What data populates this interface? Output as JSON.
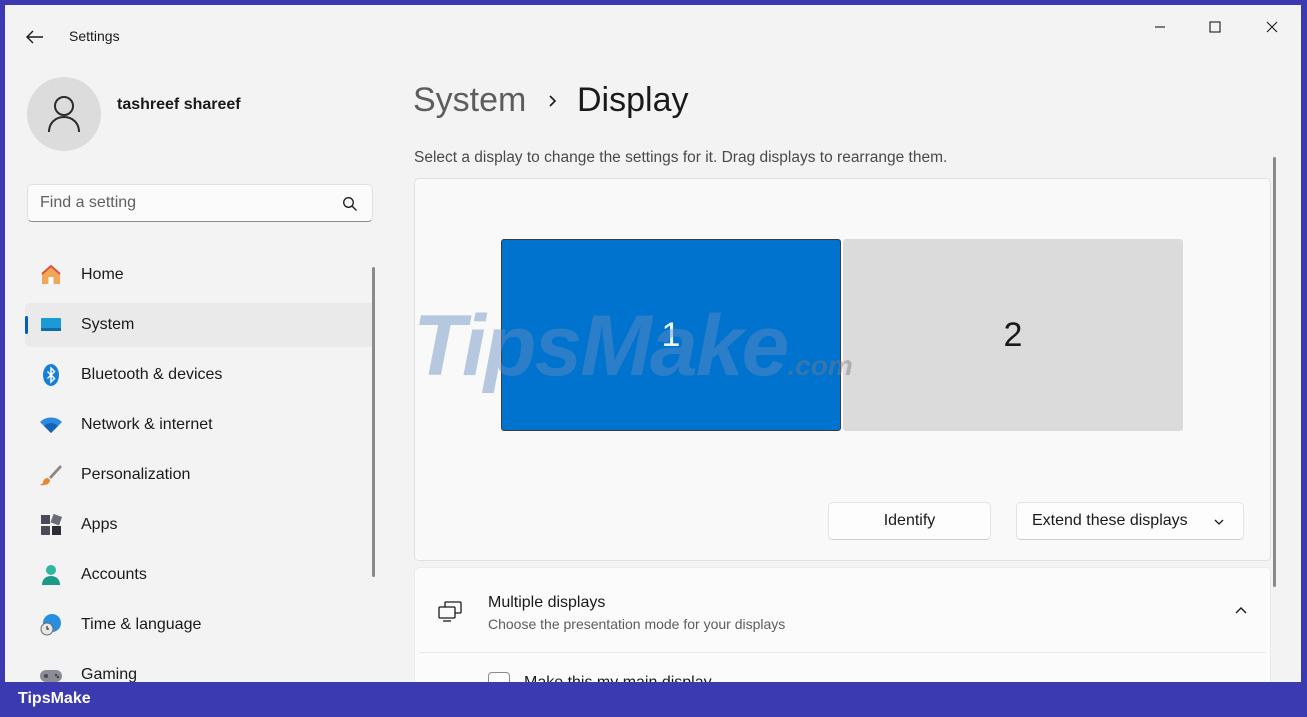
{
  "window": {
    "title": "Settings",
    "controls": [
      "minimize",
      "maximize",
      "close"
    ]
  },
  "user": {
    "name": "tashreef shareef"
  },
  "search": {
    "placeholder": "Find a setting"
  },
  "sidebar": {
    "items": [
      {
        "label": "Home",
        "icon": "home-icon",
        "active": false
      },
      {
        "label": "System",
        "icon": "system-icon",
        "active": true
      },
      {
        "label": "Bluetooth & devices",
        "icon": "bluetooth-icon",
        "active": false
      },
      {
        "label": "Network & internet",
        "icon": "wifi-icon",
        "active": false
      },
      {
        "label": "Personalization",
        "icon": "brush-icon",
        "active": false
      },
      {
        "label": "Apps",
        "icon": "apps-icon",
        "active": false
      },
      {
        "label": "Accounts",
        "icon": "accounts-icon",
        "active": false
      },
      {
        "label": "Time & language",
        "icon": "time-language-icon",
        "active": false
      },
      {
        "label": "Gaming",
        "icon": "gaming-icon",
        "active": false
      }
    ]
  },
  "breadcrumb": {
    "parent": "System",
    "current": "Display"
  },
  "main": {
    "subtitle": "Select a display to change the settings for it. Drag displays to rearrange them.",
    "monitors": [
      {
        "label": "1",
        "selected": true
      },
      {
        "label": "2",
        "selected": false
      }
    ],
    "identify_label": "Identify",
    "mode_label": "Extend these displays",
    "multiple_displays": {
      "title": "Multiple displays",
      "description": "Choose the presentation mode for your displays",
      "expanded": true,
      "main_display_label": "Make this my main display"
    }
  },
  "watermark": {
    "text": "TipsMake",
    "suffix": ".com"
  },
  "footer": {
    "brand": "TipsMake"
  },
  "colors": {
    "accent": "#005fb8",
    "selected_monitor": "#0073cf",
    "frame": "#3c3ab0"
  }
}
